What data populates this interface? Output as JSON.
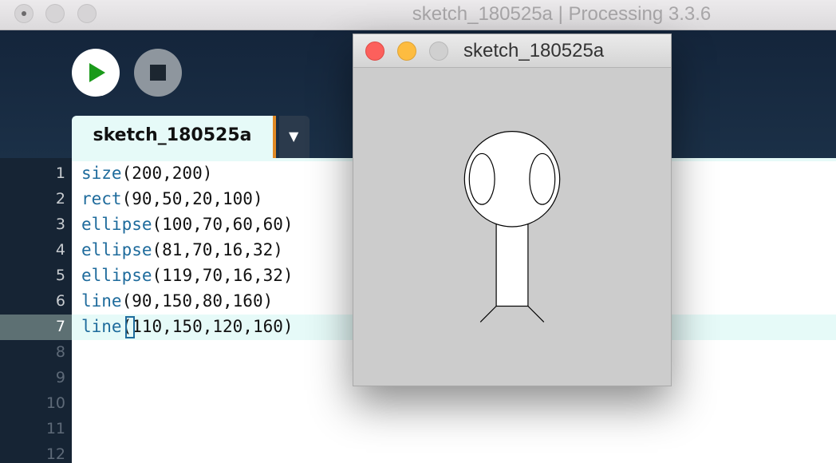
{
  "app": {
    "window_title": "sketch_180525a | Processing 3.3.6"
  },
  "toolbar": {
    "run_icon": "play-icon",
    "stop_icon": "stop-icon"
  },
  "tabs": [
    {
      "label": "sketch_180525a",
      "active": true
    }
  ],
  "tab_menu_glyph": "▼",
  "editor": {
    "current_line": 7,
    "lines": [
      {
        "num": "1",
        "fn": "size",
        "args": "(200,200)"
      },
      {
        "num": "2",
        "fn": "rect",
        "args": "(90,50,20,100)"
      },
      {
        "num": "3",
        "fn": "ellipse",
        "args": "(100,70,60,60)"
      },
      {
        "num": "4",
        "fn": "ellipse",
        "args": "(81,70,16,32)"
      },
      {
        "num": "5",
        "fn": "ellipse",
        "args": "(119,70,16,32)"
      },
      {
        "num": "6",
        "fn": "line",
        "args": "(90,150,80,160)"
      },
      {
        "num": "7",
        "fn": "line",
        "args": "(110,150,120,160)"
      },
      {
        "num": "8",
        "fn": "",
        "args": ""
      },
      {
        "num": "9",
        "fn": "",
        "args": ""
      },
      {
        "num": "10",
        "fn": "",
        "args": ""
      },
      {
        "num": "11",
        "fn": "",
        "args": ""
      },
      {
        "num": "12",
        "fn": "",
        "args": ""
      }
    ]
  },
  "sketch_window": {
    "title": "sketch_180525a",
    "background": "#cccccc"
  },
  "colors": {
    "keyword": "#1e6b9c",
    "toolbar_bg": "#14253b",
    "tab_accent": "#e08a25",
    "run_icon": "#1a9a1a"
  }
}
